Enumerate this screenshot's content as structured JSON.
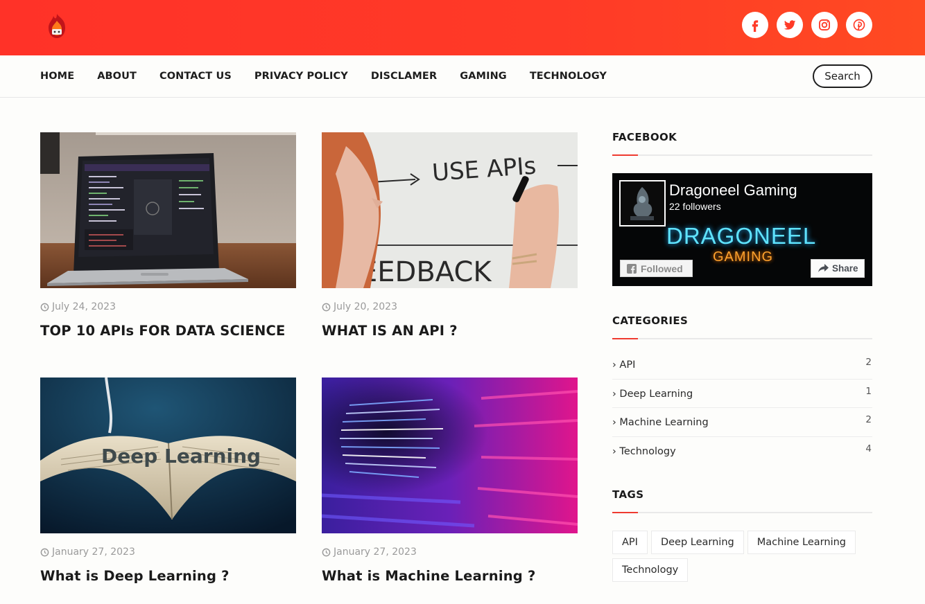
{
  "header": {
    "social": [
      "facebook-icon",
      "twitter-icon",
      "instagram-icon",
      "pinterest-icon"
    ]
  },
  "nav": {
    "items": [
      "HOME",
      "ABOUT",
      "CONTACT US",
      "PRIVACY POLICY",
      "DISCLAMER",
      "GAMING",
      "TECHNOLOGY"
    ],
    "search_label": "Search"
  },
  "posts": [
    {
      "date": "July 24, 2023",
      "title": "TOP 10 APIs FOR DATA SCIENCE"
    },
    {
      "date": "July 20, 2023",
      "title": "WHAT IS AN API ?",
      "image_text": "USE APIs",
      "image_text2": "EEDBACK"
    },
    {
      "date": "January 27, 2023",
      "title": "What is Deep Learning ?",
      "image_text": "Deep Learning"
    },
    {
      "date": "January 27, 2023",
      "title": "What is Machine Learning ?"
    }
  ],
  "sidebar": {
    "facebook": {
      "heading": "FACEBOOK",
      "page_name": "Dragoneel Gaming",
      "followers": "22 followers",
      "brand_line1": "DRAGONEEL",
      "brand_line2": "GAMING",
      "followed_label": "Followed",
      "share_label": "Share"
    },
    "categories": {
      "heading": "CATEGORIES",
      "items": [
        {
          "label": "API",
          "count": "2"
        },
        {
          "label": "Deep Learning",
          "count": "1"
        },
        {
          "label": "Machine Learning",
          "count": "2"
        },
        {
          "label": "Technology",
          "count": "4"
        }
      ]
    },
    "tags": {
      "heading": "TAGS",
      "items": [
        "API",
        "Deep Learning",
        "Machine Learning",
        "Technology"
      ]
    }
  },
  "colors": {
    "header_red": "#ff3228",
    "accent": "#ef3a2f"
  }
}
